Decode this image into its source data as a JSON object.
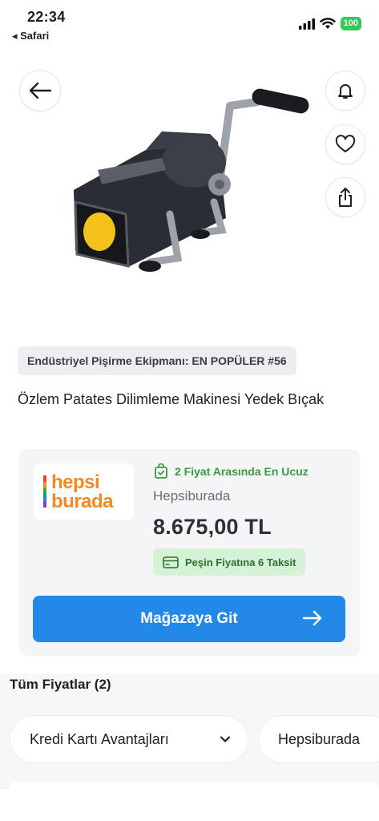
{
  "status_bar": {
    "time": "22:34",
    "back_app": "◂ Safari",
    "battery": "100"
  },
  "actions": {
    "back": "back-arrow-icon",
    "notify": "bell-icon",
    "favorite": "heart-icon",
    "share": "share-icon"
  },
  "product": {
    "rank_badge": "Endüstriyel Pişirme Ekipmanı: EN POPÜLER #56",
    "title": "Özlem Patates Dilimleme Makinesi Yedek Bıçak"
  },
  "offer": {
    "logo_line1": "hepsi",
    "logo_line2": "burada",
    "cheapest_label": "2 Fiyat Arasında En Ucuz",
    "seller_name": "Hepsiburada",
    "price": "8.675,00 TL",
    "installment_label": "Peşin Fiyatına 6 Taksit",
    "store_button": "Mağazaya Git"
  },
  "all_prices": {
    "heading": "Tüm Fiyatlar (2)",
    "filters": [
      "Kredi Kartı Avantajları",
      "Hepsiburada"
    ]
  },
  "colors": {
    "accent_blue": "#2389e8",
    "success_green": "#3c9a3f",
    "installment_bg": "#d6f2d6",
    "logo_orange": "#f28a1d"
  }
}
